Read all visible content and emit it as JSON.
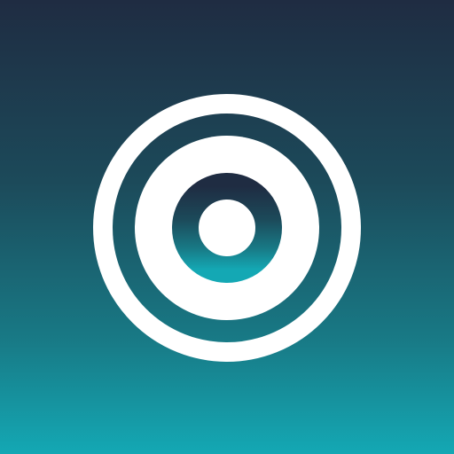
{
  "app_icon": {
    "icon": "concentric-circles-target-icon",
    "colors": {
      "background_top": "#1f2c42",
      "background_bottom": "#14a8b4",
      "foreground": "#ffffff"
    }
  }
}
